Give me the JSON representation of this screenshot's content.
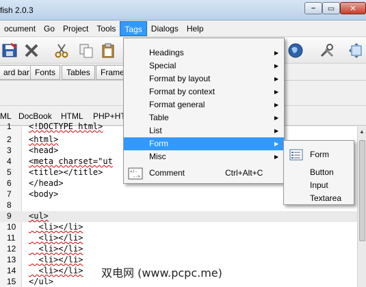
{
  "window": {
    "title": "fish 2.0.3"
  },
  "menubar": {
    "items": [
      {
        "label": "ocument"
      },
      {
        "label": "Go"
      },
      {
        "label": "Project"
      },
      {
        "label": "Tools"
      },
      {
        "label": "Tags"
      },
      {
        "label": "Dialogs"
      },
      {
        "label": "Help"
      }
    ]
  },
  "quickbar": {
    "tabs": [
      {
        "label": "ard bar"
      },
      {
        "label": "Fonts"
      },
      {
        "label": "Tables"
      },
      {
        "label": "Frame"
      }
    ]
  },
  "doctabs": {
    "tabs": [
      {
        "label": "ML"
      },
      {
        "label": "DocBook"
      },
      {
        "label": "HTML"
      },
      {
        "label": "PHP+HT"
      }
    ]
  },
  "editor": {
    "lines": [
      {
        "num": "1",
        "code": "<!DOCTYPE html>"
      },
      {
        "num": "2",
        "code": "<html>"
      },
      {
        "num": "3",
        "code": "<head>"
      },
      {
        "num": "4",
        "code": "<meta charset=\"ut"
      },
      {
        "num": "5",
        "code": "<title></title>"
      },
      {
        "num": "6",
        "code": "</head>"
      },
      {
        "num": "7",
        "code": "<body>"
      },
      {
        "num": "8",
        "code": ""
      },
      {
        "num": "9",
        "code": "<ul>"
      },
      {
        "num": "10",
        "code": "  <li></li>"
      },
      {
        "num": "11",
        "code": "  <li></li>"
      },
      {
        "num": "12",
        "code": "  <li></li>"
      },
      {
        "num": "13",
        "code": "  <li></li>"
      },
      {
        "num": "14",
        "code": "  <li></li>"
      },
      {
        "num": "15",
        "code": "</ul>"
      }
    ]
  },
  "tags_menu": {
    "items": [
      {
        "label": "Headings",
        "submenu": true
      },
      {
        "label": "Special",
        "submenu": true
      },
      {
        "label": "Format by layout",
        "submenu": true
      },
      {
        "label": "Format by context",
        "submenu": true
      },
      {
        "label": "Format general",
        "submenu": true
      },
      {
        "label": "Table",
        "submenu": true
      },
      {
        "label": "List",
        "submenu": true
      },
      {
        "label": "Form",
        "submenu": true
      },
      {
        "label": "Misc",
        "submenu": true
      },
      {
        "label": "Comment",
        "shortcut": "Ctrl+Alt+C",
        "icon": "comment-icon"
      }
    ]
  },
  "form_submenu": {
    "items": [
      {
        "label": "Form",
        "icon": "form-icon"
      },
      {
        "label": "Button"
      },
      {
        "label": "Input"
      },
      {
        "label": "Textarea"
      }
    ]
  },
  "watermark": {
    "text": "双电网 (www.pcpc.me)"
  },
  "colors": {
    "highlight": "#3399ff",
    "titlebar": "#b9d1ea"
  }
}
